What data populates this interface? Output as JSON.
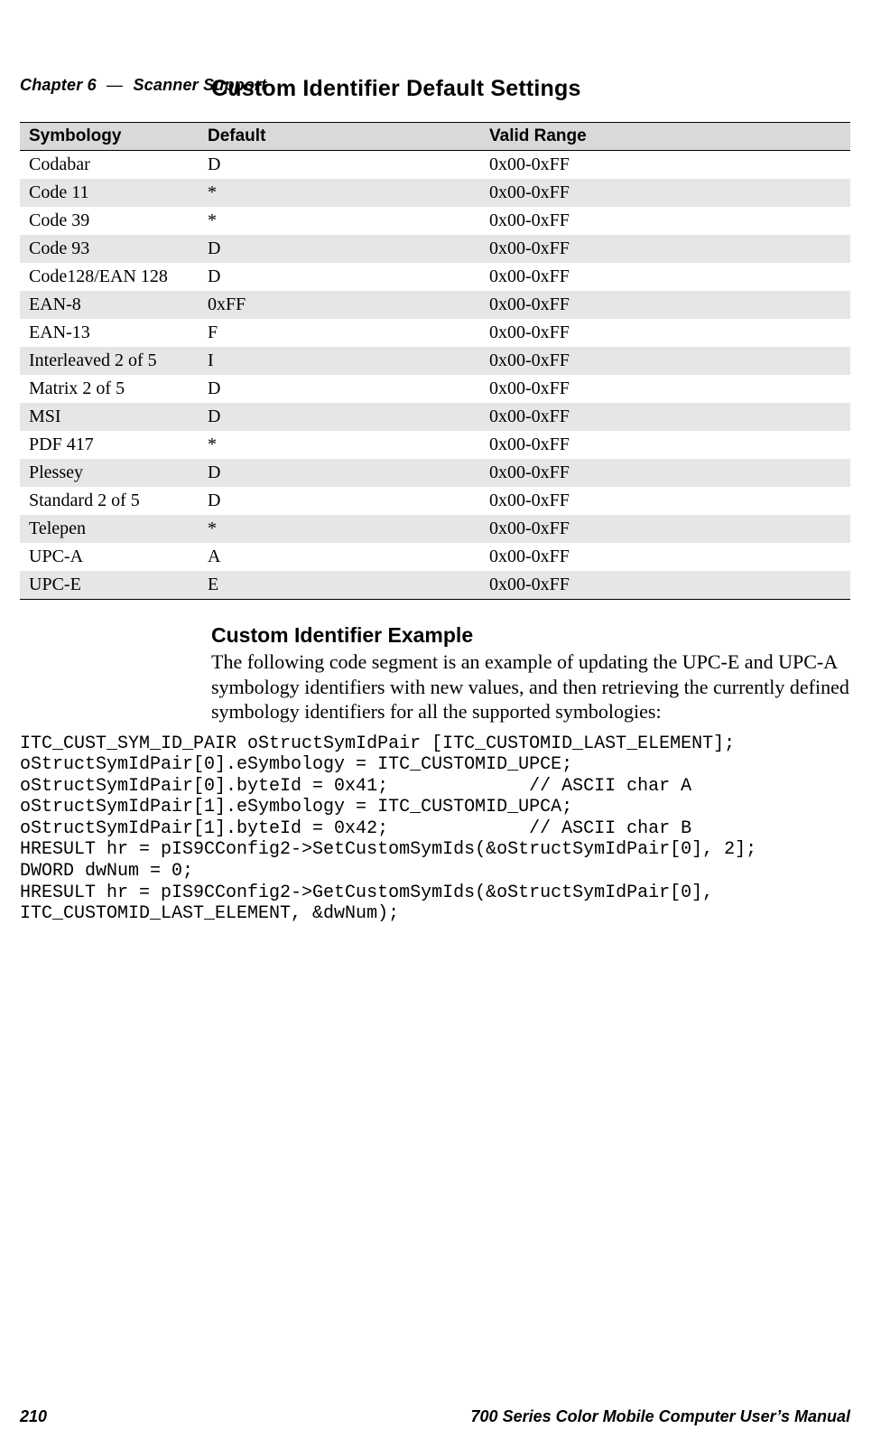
{
  "header": {
    "chapter": "Chapter 6",
    "dash": "—",
    "section": "Scanner Support"
  },
  "headings": {
    "h1": "Custom Identifier Default Settings",
    "h2": "Custom Identifier Example"
  },
  "table": {
    "columns": [
      "Symbology",
      "Default",
      "Valid Range"
    ],
    "rows": [
      {
        "sym": "Codabar",
        "def": "D",
        "range": "0x00-0xFF"
      },
      {
        "sym": "Code 11",
        "def": "*",
        "range": "0x00-0xFF"
      },
      {
        "sym": "Code 39",
        "def": "*",
        "range": "0x00-0xFF"
      },
      {
        "sym": "Code 93",
        "def": "D",
        "range": "0x00-0xFF"
      },
      {
        "sym": "Code128/EAN 128",
        "def": "D",
        "range": "0x00-0xFF"
      },
      {
        "sym": "EAN-8",
        "def": "0xFF",
        "range": "0x00-0xFF"
      },
      {
        "sym": "EAN-13",
        "def": "F",
        "range": "0x00-0xFF"
      },
      {
        "sym": "Interleaved 2 of 5",
        "def": "I",
        "range": "0x00-0xFF"
      },
      {
        "sym": "Matrix 2 of 5",
        "def": "D",
        "range": "0x00-0xFF"
      },
      {
        "sym": "MSI",
        "def": "D",
        "range": "0x00-0xFF"
      },
      {
        "sym": "PDF 417",
        "def": "*",
        "range": "0x00-0xFF"
      },
      {
        "sym": "Plessey",
        "def": "D",
        "range": "0x00-0xFF"
      },
      {
        "sym": "Standard 2 of 5",
        "def": "D",
        "range": "0x00-0xFF"
      },
      {
        "sym": "Telepen",
        "def": "*",
        "range": "0x00-0xFF"
      },
      {
        "sym": "UPC-A",
        "def": "A",
        "range": "0x00-0xFF"
      },
      {
        "sym": "UPC-E",
        "def": "E",
        "range": "0x00-0xFF"
      }
    ]
  },
  "paragraph": "The following code segment is an example of updating the UPC-E and UPC-A symbology identifiers with new values, and then retrieving the currently defined symbology identifiers for all the supported symbologies:",
  "code": "ITC_CUST_SYM_ID_PAIR oStructSymIdPair [ITC_CUSTOMID_LAST_ELEMENT];\noStructSymIdPair[0].eSymbology = ITC_CUSTOMID_UPCE;\noStructSymIdPair[0].byteId = 0x41;             // ASCII char A\noStructSymIdPair[1].eSymbology = ITC_CUSTOMID_UPCA;\noStructSymIdPair[1].byteId = 0x42;             // ASCII char B\nHRESULT hr = pIS9CConfig2->SetCustomSymIds(&oStructSymIdPair[0], 2];\nDWORD dwNum = 0;\nHRESULT hr = pIS9CConfig2->GetCustomSymIds(&oStructSymIdPair[0],\nITC_CUSTOMID_LAST_ELEMENT, &dwNum);",
  "footer": {
    "page": "210",
    "manual": "700 Series Color Mobile Computer User’s Manual"
  }
}
